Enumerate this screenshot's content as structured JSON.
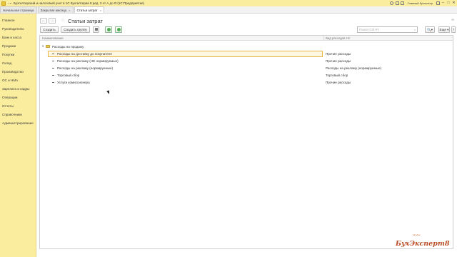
{
  "titlebar": {
    "title": "Бухгалтерский и налоговый учет в 1С Бухгалтерия 8 ред. 3 от А до Я (1С:Предприятие)",
    "user": "Главный бухгалтер",
    "minimize": "–",
    "maximize": "□",
    "close": "✕"
  },
  "tabs": [
    {
      "label": "Начальная страница",
      "close": ""
    },
    {
      "label": "Закрытие месяца",
      "close": "×"
    },
    {
      "label": "Статьи затрат",
      "close": "×"
    }
  ],
  "sidebar": {
    "items": [
      "Главное",
      "Руководителю",
      "Банк и касса",
      "Продажи",
      "Покупки",
      "Склад",
      "Производство",
      "ОС и НМА",
      "Зарплата и кадры",
      "Операции",
      "Отчеты",
      "Справочники",
      "Администрирование"
    ]
  },
  "page": {
    "back": "←",
    "forward": "→",
    "star": "☆",
    "title": "Статьи затрат",
    "link_icon": "∞"
  },
  "toolbar": {
    "create": "Создать",
    "create_group": "Создать группу",
    "save_icon": "floppy-icon",
    "green_up": "green-arrow-icon",
    "green_down": "green-arrow-icon",
    "search_placeholder": "Поиск (Ctrl+F)",
    "search_clear": "×",
    "search_btn": "🔍▾",
    "more": "Еще ▾",
    "help": "?"
  },
  "grid": {
    "columns": [
      "Наименование",
      "Вид расходов НУ"
    ],
    "group": "Расходы на продажу",
    "rows": [
      {
        "name": "Расходы на доставку до покупателя",
        "type": "Прочие расходы",
        "selected": true
      },
      {
        "name": "Расходы на рекламу (НЕ нормируемые)",
        "type": "Прочие расходы",
        "selected": false
      },
      {
        "name": "Расходы на рекламу (нормируемые)",
        "type": "Расходы на рекламу (нормируемые)",
        "selected": false
      },
      {
        "name": "Торговый сбор",
        "type": "Торговый сбор",
        "selected": false
      },
      {
        "name": "Услуги комиссионера",
        "type": "Прочие расходы",
        "selected": false
      }
    ]
  },
  "watermark": {
    "brand": "БухЭксперт8",
    "crown": "ᴗᴗᴗ"
  },
  "colors": {
    "titlebar": "#fbed9e",
    "sidebar": "#fbed9e",
    "selection_border": "#e6b84a",
    "accent_green": "#4caf50",
    "brand": "#bb4e25"
  }
}
